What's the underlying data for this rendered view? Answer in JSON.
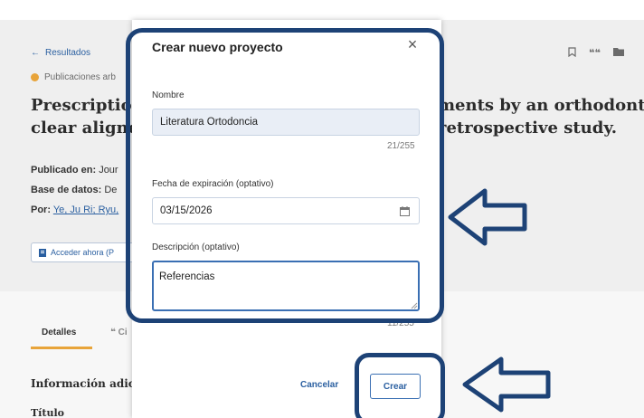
{
  "background": {
    "back_link": "Resultados",
    "pub_type": "Publicaciones arb",
    "title_left_line1": "Prescription",
    "title_left_line2": "clear aligne",
    "title_right_line1": "ments by an orthodontic",
    "title_right_line2": "retrospective study.",
    "published_label": "Publicado en:",
    "published_value": "Jour",
    "database_label": "Base de datos:",
    "database_value": "De",
    "authors_label": "Por:",
    "authors_value": "Ye, Ju Ri; Ryu,",
    "access_button": "Acceder ahora (P",
    "tab_details": "Detalles",
    "tab_cite": "Ci",
    "info_heading": "Información adici",
    "titulo": "Título"
  },
  "modal": {
    "title": "Crear nuevo proyecto",
    "close_symbol": "×",
    "name_label": "Nombre",
    "name_value": "Literatura Ortodoncia",
    "name_counter": "21/255",
    "expiry_label": "Fecha de expiración (optativo)",
    "expiry_value": "03/15/2026",
    "description_label": "Descripción (optativo)",
    "description_value": "Referencias",
    "description_counter": "11/255",
    "cancel_label": "Cancelar",
    "create_label": "Crear"
  },
  "colors": {
    "accent": "#2a5fa0",
    "annotation": "#1d4276",
    "highlight": "#e8a43a"
  },
  "icons": [
    "arrow-left-icon",
    "badge-dot-icon",
    "bookmark-icon",
    "quote-icon",
    "folder-icon",
    "calendar-icon",
    "close-icon",
    "pdf-icon"
  ]
}
